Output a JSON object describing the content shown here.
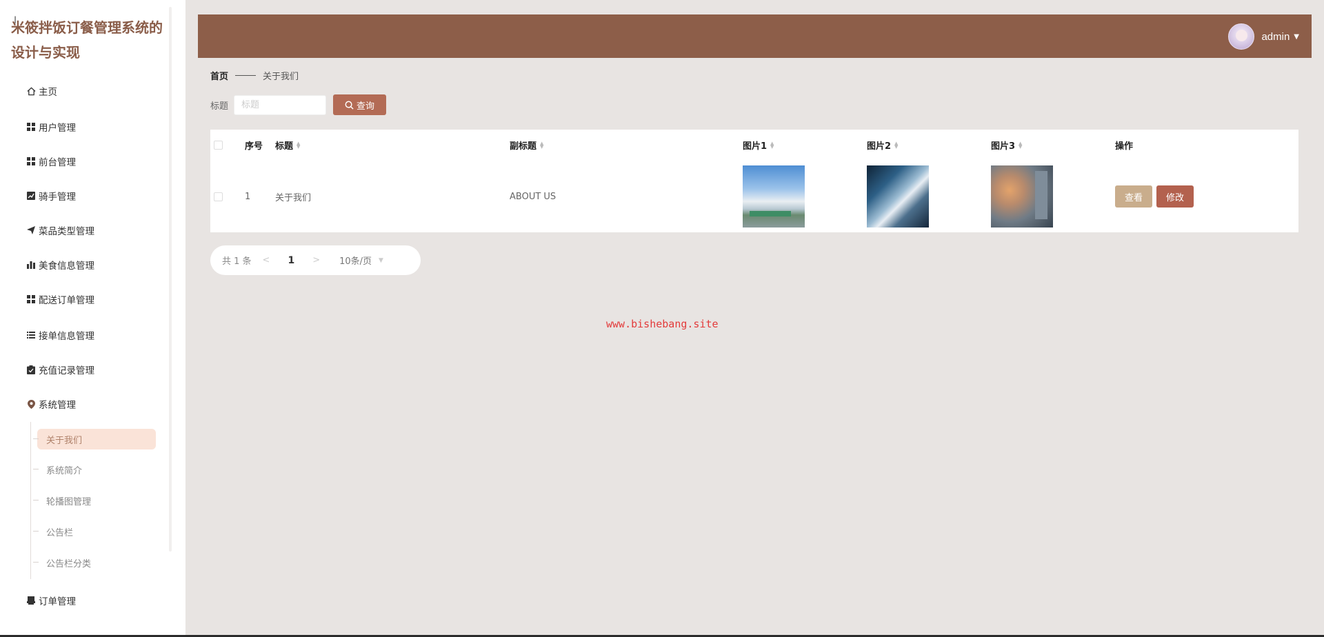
{
  "app": {
    "title": "米筱拌饭订餐管理系统的设计与实现"
  },
  "sidebar": {
    "items": [
      {
        "label": "主页",
        "icon": "home-icon"
      },
      {
        "label": "用户管理",
        "icon": "grid-icon"
      },
      {
        "label": "前台管理",
        "icon": "grid-icon"
      },
      {
        "label": "骑手管理",
        "icon": "chart-icon"
      },
      {
        "label": "菜品类型管理",
        "icon": "send-icon"
      },
      {
        "label": "美食信息管理",
        "icon": "bar-chart-icon"
      },
      {
        "label": "配送订单管理",
        "icon": "grid-icon"
      },
      {
        "label": "接单信息管理",
        "icon": "list-icon"
      },
      {
        "label": "充值记录管理",
        "icon": "clipboard-icon"
      },
      {
        "label": "系统管理",
        "icon": "location-icon"
      },
      {
        "label": "订单管理",
        "icon": "printer-icon"
      }
    ],
    "subitems": [
      {
        "label": "关于我们",
        "active": true
      },
      {
        "label": "系统简介",
        "active": false
      },
      {
        "label": "轮播图管理",
        "active": false
      },
      {
        "label": "公告栏",
        "active": false
      },
      {
        "label": "公告栏分类",
        "active": false
      }
    ]
  },
  "header": {
    "username": "admin",
    "bg_color": "#8d5e49"
  },
  "breadcrumb": {
    "home": "首页",
    "current": "关于我们"
  },
  "search": {
    "label": "标题",
    "placeholder": "标题",
    "value": "",
    "button_label": "查询"
  },
  "table": {
    "headers": {
      "index": "序号",
      "title": "标题",
      "subtitle": "副标题",
      "pic1": "图片1",
      "pic2": "图片2",
      "pic3": "图片3",
      "actions": "操作"
    },
    "rows": [
      {
        "index": "1",
        "title": "关于我们",
        "subtitle": "ABOUT US",
        "view_label": "查看",
        "edit_label": "修改"
      }
    ]
  },
  "pagination": {
    "total": "共 1 条",
    "prev": "<",
    "page": "1",
    "next": ">",
    "page_size": "10条/页"
  },
  "watermark": "www.bishebang.site",
  "colors": {
    "accent": "#b36b55",
    "view_button": "#c9ad8c",
    "edit_button": "#b3614e",
    "background": "#e8e4e2"
  }
}
